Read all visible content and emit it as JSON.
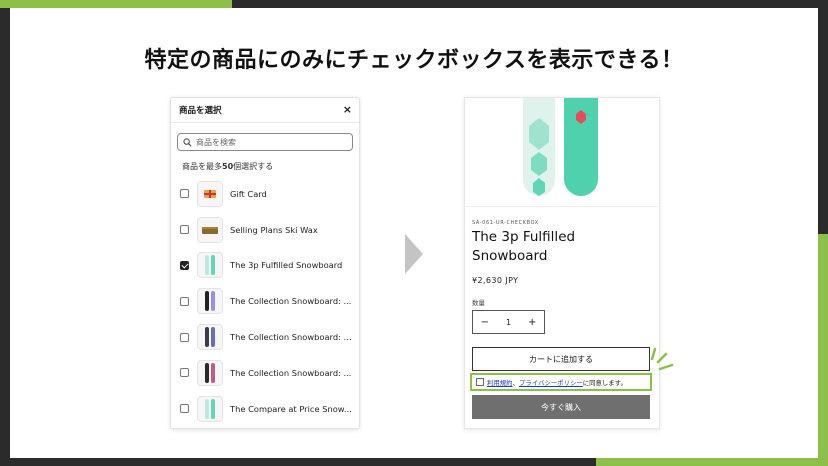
{
  "headline": "特定の商品にのみにチェックボックスを表示できる！",
  "modal": {
    "title": "商品を選択",
    "close_icon": "×",
    "search_placeholder": "商品を検索",
    "limit_prefix": "商品を最多",
    "limit_number": "50",
    "limit_suffix": "個選択する",
    "products": [
      {
        "name": "Gift Card",
        "checked": false
      },
      {
        "name": "Selling Plans Ski Wax",
        "checked": false
      },
      {
        "name": "The 3p Fulfilled Snowboard",
        "checked": true
      },
      {
        "name": "The Collection Snowboard: ...",
        "checked": false
      },
      {
        "name": "The Collection Snowboard: L...",
        "checked": false
      },
      {
        "name": "The Collection Snowboard: ...",
        "checked": false
      },
      {
        "name": "The Compare at Price Snow...",
        "checked": false
      }
    ]
  },
  "product": {
    "sku": "SA-061-UR-CHECKBOX",
    "title": "The 3p Fulfilled Snowboard",
    "price": "¥2,630 JPY",
    "qty_label": "数量",
    "qty_minus": "−",
    "qty_value": "1",
    "qty_plus": "+",
    "add_to_cart": "カートに追加する",
    "consent_terms_link": "利用規約",
    "consent_sep": "、",
    "consent_privacy_link": "プライバシーポリシー",
    "consent_suffix": "に同意します。",
    "buy_now": "今すぐ購入"
  },
  "colors": {
    "accent_green": "#8cc04a",
    "dark": "#2b2b2b",
    "board_teal": "#5fd6b6",
    "buy_button": "#6f6f6f"
  }
}
